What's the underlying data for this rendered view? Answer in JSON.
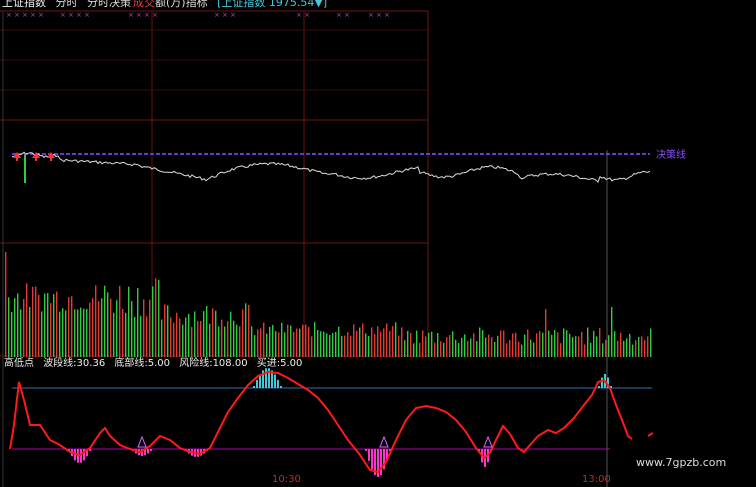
{
  "header": {
    "index_name": "上证指数",
    "mode": "分时",
    "strategy": "分时决策",
    "volume_label_a": "成交",
    "volume_label_b": "额(万)",
    "indicator_label": "指标",
    "index_quote": "[上证指数 1975.54▼]"
  },
  "decision_line_label": "决策线",
  "indicator_panel": {
    "name": "高低点",
    "wave_line": "波段线:30.36",
    "bottom_line": "底部线:5.00",
    "risk_line": "风险线:108.00",
    "buy_in": "买进:5.00"
  },
  "time_labels": [
    "10:30",
    "13:00"
  ],
  "watermark": "www.7gpzb.com",
  "colors": {
    "up": "#e53935",
    "down": "#2ecc40",
    "decision": "#8a4dff",
    "risk_line": "#2f6fb5",
    "bottom_line": "#b300b3",
    "top_bars": "#46c8d8",
    "bottom_bars": "#ff33cc",
    "wave": "#ff1a1a"
  }
}
